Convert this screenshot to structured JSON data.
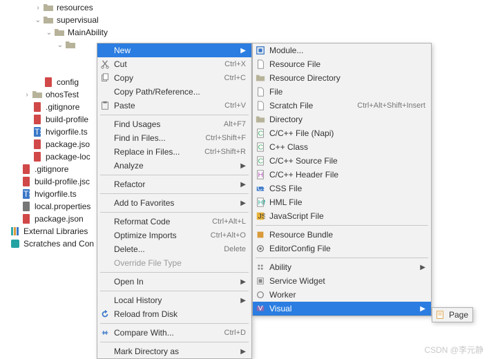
{
  "tree": {
    "items": [
      {
        "indent": 3,
        "arrow": ">",
        "icon": "folder",
        "label": "resources"
      },
      {
        "indent": 3,
        "arrow": "v",
        "icon": "folder",
        "label": "supervisual"
      },
      {
        "indent": 4,
        "arrow": "v",
        "icon": "folder",
        "label": "MainAbility"
      },
      {
        "indent": 5,
        "arrow": "v",
        "icon": "folder-sel",
        "label": ""
      },
      {
        "indent": 5,
        "arrow": "",
        "icon": "",
        "label": ""
      },
      {
        "indent": 5,
        "arrow": "",
        "icon": "",
        "label": ""
      },
      {
        "indent": 3,
        "arrow": "",
        "icon": "file-red",
        "label": "config"
      },
      {
        "indent": 2,
        "arrow": ">",
        "icon": "folder",
        "label": "ohosTest"
      },
      {
        "indent": 2,
        "arrow": "",
        "icon": "file-red",
        "label": ".gitignore"
      },
      {
        "indent": 2,
        "arrow": "",
        "icon": "file-red",
        "label": "build-profile"
      },
      {
        "indent": 2,
        "arrow": "",
        "icon": "file-ts",
        "label": "hvigorfile.ts"
      },
      {
        "indent": 2,
        "arrow": "",
        "icon": "file-red",
        "label": "package.jso"
      },
      {
        "indent": 2,
        "arrow": "",
        "icon": "file-red",
        "label": "package-loc"
      },
      {
        "indent": 1,
        "arrow": "",
        "icon": "file-red",
        "label": ".gitignore"
      },
      {
        "indent": 1,
        "arrow": "",
        "icon": "file-red",
        "label": "build-profile.jsc"
      },
      {
        "indent": 1,
        "arrow": "",
        "icon": "file-ts",
        "label": "hvigorfile.ts"
      },
      {
        "indent": 1,
        "arrow": "",
        "icon": "file-gray",
        "label": "local.properties"
      },
      {
        "indent": 1,
        "arrow": "",
        "icon": "file-red",
        "label": "package.json"
      },
      {
        "indent": 0,
        "arrow": "",
        "icon": "lib",
        "label": "External Libraries"
      },
      {
        "indent": 0,
        "arrow": "",
        "icon": "scratch",
        "label": "Scratches and Con"
      }
    ]
  },
  "menu1": [
    {
      "type": "item",
      "icon": "",
      "label": "New",
      "shortcut": "",
      "sub": true,
      "hl": true
    },
    {
      "type": "item",
      "icon": "cut",
      "label": "Cut",
      "shortcut": "Ctrl+X",
      "u": "t"
    },
    {
      "type": "item",
      "icon": "copy",
      "label": "Copy",
      "shortcut": "Ctrl+C",
      "u": "C"
    },
    {
      "type": "item",
      "icon": "",
      "label": "Copy Path/Reference...",
      "shortcut": ""
    },
    {
      "type": "item",
      "icon": "paste",
      "label": "Paste",
      "shortcut": "Ctrl+V",
      "u": "P"
    },
    {
      "type": "sep"
    },
    {
      "type": "item",
      "icon": "",
      "label": "Find Usages",
      "shortcut": "Alt+F7",
      "u": "U"
    },
    {
      "type": "item",
      "icon": "",
      "label": "Find in Files...",
      "shortcut": "Ctrl+Shift+F"
    },
    {
      "type": "item",
      "icon": "",
      "label": "Replace in Files...",
      "shortcut": "Ctrl+Shift+R",
      "u": "R"
    },
    {
      "type": "item",
      "icon": "",
      "label": "Analyze",
      "shortcut": "",
      "sub": true,
      "u": "z"
    },
    {
      "type": "sep"
    },
    {
      "type": "item",
      "icon": "",
      "label": "Refactor",
      "shortcut": "",
      "sub": true,
      "u": "R"
    },
    {
      "type": "sep"
    },
    {
      "type": "item",
      "icon": "",
      "label": "Add to Favorites",
      "shortcut": "",
      "sub": true,
      "u": "F"
    },
    {
      "type": "sep"
    },
    {
      "type": "item",
      "icon": "",
      "label": "Reformat Code",
      "shortcut": "Ctrl+Alt+L",
      "u": "R"
    },
    {
      "type": "item",
      "icon": "",
      "label": "Optimize Imports",
      "shortcut": "Ctrl+Alt+O",
      "u": "z"
    },
    {
      "type": "item",
      "icon": "",
      "label": "Delete...",
      "shortcut": "Delete",
      "u": "D"
    },
    {
      "type": "item",
      "icon": "",
      "label": "Override File Type",
      "shortcut": "",
      "disabled": true
    },
    {
      "type": "sep"
    },
    {
      "type": "item",
      "icon": "",
      "label": "Open In",
      "shortcut": "",
      "sub": true
    },
    {
      "type": "sep"
    },
    {
      "type": "item",
      "icon": "",
      "label": "Local History",
      "shortcut": "",
      "sub": true,
      "u": "H"
    },
    {
      "type": "item",
      "icon": "reload",
      "label": "Reload from Disk",
      "shortcut": ""
    },
    {
      "type": "sep"
    },
    {
      "type": "item",
      "icon": "compare",
      "label": "Compare With...",
      "shortcut": "Ctrl+D"
    },
    {
      "type": "sep"
    },
    {
      "type": "item",
      "icon": "",
      "label": "Mark Directory as",
      "shortcut": "",
      "sub": true,
      "u": "M"
    }
  ],
  "menu2": [
    {
      "type": "item",
      "icon": "module",
      "label": "Module..."
    },
    {
      "type": "item",
      "icon": "res-file",
      "label": "Resource File"
    },
    {
      "type": "item",
      "icon": "res-dir",
      "label": "Resource Directory"
    },
    {
      "type": "item",
      "icon": "file",
      "label": "File"
    },
    {
      "type": "item",
      "icon": "scratch-file",
      "label": "Scratch File",
      "shortcut": "Ctrl+Alt+Shift+Insert"
    },
    {
      "type": "item",
      "icon": "dir",
      "label": "Directory"
    },
    {
      "type": "item",
      "icon": "cpp",
      "label": "C/C++ File (Napi)"
    },
    {
      "type": "item",
      "icon": "cpp-class",
      "label": "C++ Class"
    },
    {
      "type": "item",
      "icon": "cpp-src",
      "label": "C/C++ Source File"
    },
    {
      "type": "item",
      "icon": "cpp-hdr",
      "label": "C/C++ Header File"
    },
    {
      "type": "item",
      "icon": "css",
      "label": "CSS File"
    },
    {
      "type": "item",
      "icon": "hml",
      "label": "HML File"
    },
    {
      "type": "item",
      "icon": "js",
      "label": "JavaScript File"
    },
    {
      "type": "sep"
    },
    {
      "type": "item",
      "icon": "bundle",
      "label": "Resource Bundle"
    },
    {
      "type": "item",
      "icon": "editorconfig",
      "label": "EditorConfig File"
    },
    {
      "type": "sep"
    },
    {
      "type": "item",
      "icon": "ability",
      "label": "Ability",
      "sub": true
    },
    {
      "type": "item",
      "icon": "widget",
      "label": "Service Widget"
    },
    {
      "type": "item",
      "icon": "worker",
      "label": "Worker"
    },
    {
      "type": "item",
      "icon": "visual",
      "label": "Visual",
      "sub": true,
      "hl": true
    }
  ],
  "menu3": [
    {
      "type": "item",
      "icon": "page",
      "label": "Page"
    }
  ],
  "watermark": "CSDN @李元静"
}
